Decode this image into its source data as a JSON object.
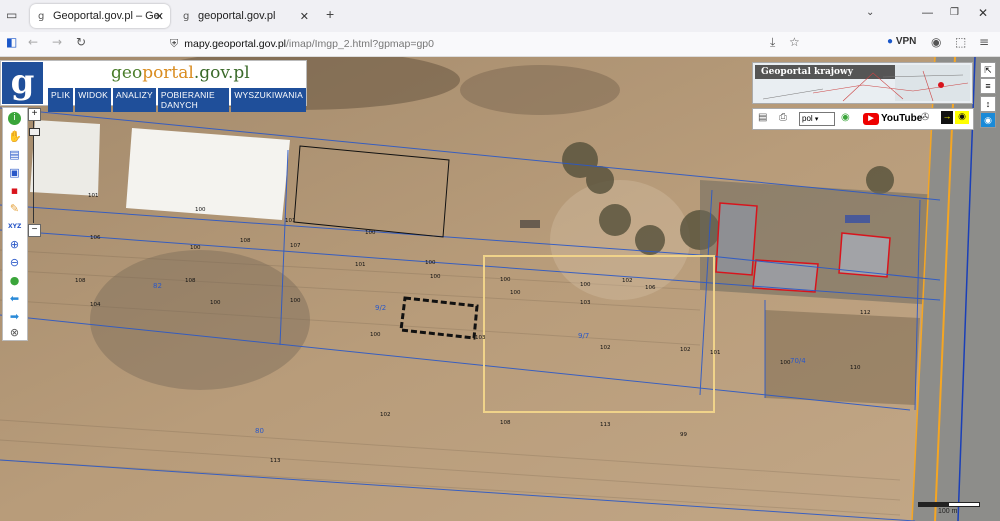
{
  "browser": {
    "tabs": [
      {
        "label": "Geoportal.gov.pl – Geoportal Info",
        "active": true
      },
      {
        "label": "geoportal.gov.pl",
        "active": false
      }
    ],
    "url_host": "mapy.geoportal.gov.pl",
    "url_path": "/imap/Imgp_2.html?gpmap=gp0",
    "vpn_label": "VPN"
  },
  "app": {
    "logo_letter": "g",
    "site_geo": "geo",
    "site_portal": "portal",
    "site_suffix": ".gov.pl",
    "menu": [
      "PLIK",
      "WIDOK",
      "ANALIZY",
      "POBIERANIE DANYCH",
      "WYSZUKIWANIA"
    ]
  },
  "toolbar_icons": [
    "info-icon",
    "hand-icon",
    "layers-icon",
    "select-icon",
    "print-icon",
    "pencil-icon",
    "xyz-icon",
    "zoom-in-icon",
    "zoom-out-icon",
    "globe-icon",
    "back-icon",
    "forward-icon",
    "help-icon"
  ],
  "toolbar_xyz": "XYZ",
  "zoom": {
    "plus": "+",
    "minus": "−"
  },
  "overview": {
    "label": "Geoportal krajowy"
  },
  "statusbar": {
    "language": "pol",
    "youtube": "YouTube"
  },
  "map": {
    "height_labels": [
      "101",
      "100",
      "101",
      "100",
      "100",
      "100",
      "100",
      "106",
      "106",
      "100",
      "108",
      "107",
      "101",
      "100",
      "100",
      "103",
      "102",
      "108",
      "108",
      "100",
      "104",
      "100",
      "100",
      "103",
      "102",
      "102",
      "101",
      "100",
      "110",
      "112",
      "113",
      "102",
      "108",
      "113",
      "99"
    ],
    "parcel_labels": [
      "82",
      "9/7",
      "9/2",
      "70/4",
      "80"
    ],
    "colors": {
      "parcel_line": "#2a58c8",
      "building": "#d8141c",
      "selection": "#f0d38a",
      "road": "#f5a623"
    }
  },
  "scale": {
    "label": "100 m"
  }
}
